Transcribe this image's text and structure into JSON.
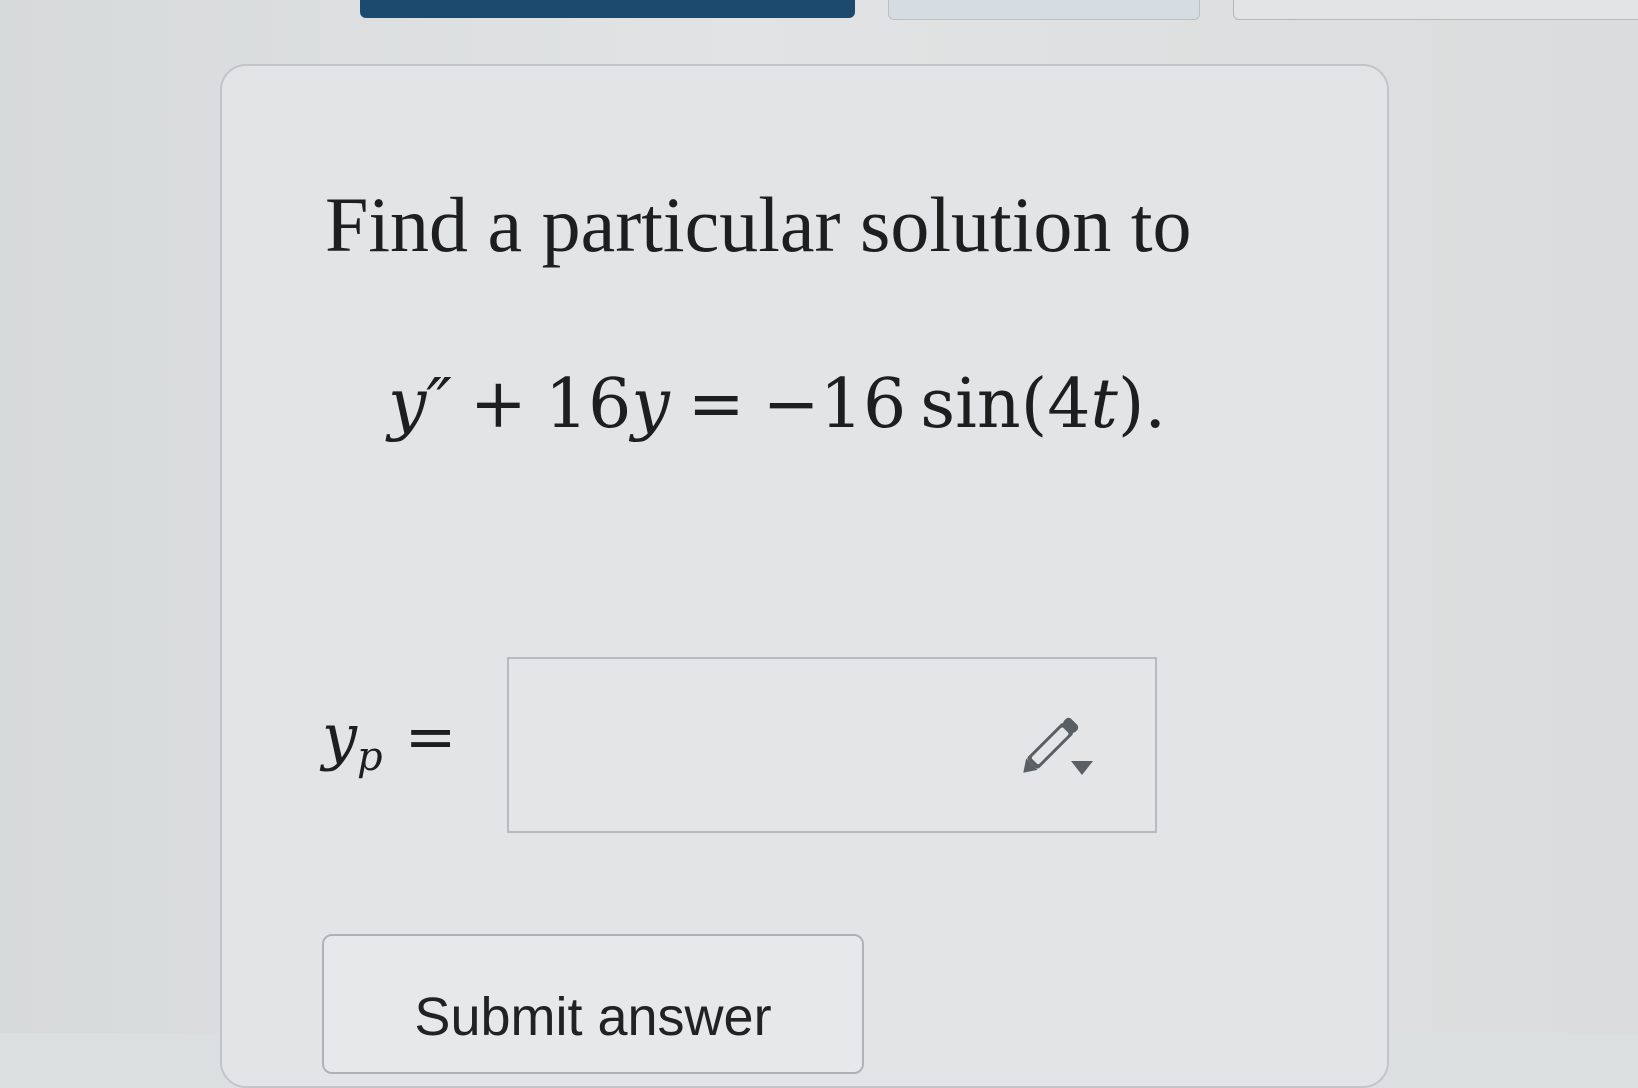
{
  "question": {
    "prompt": "Find a particular solution to",
    "equation": {
      "lhs_var": "y″",
      "plus": "+",
      "coef": "16",
      "lhs_var2": "y",
      "equals": "=",
      "minus": "−",
      "rhs_coef": "16",
      "func": "sin",
      "open_paren": "(",
      "arg_num": "4",
      "arg_var": "t",
      "close_paren": ").",
      "trailing": ""
    }
  },
  "answer": {
    "label_var": "y",
    "label_sub": "p",
    "label_eq": "=",
    "value": "",
    "edit_icon": "pencil-dropdown-icon"
  },
  "submit": {
    "label": "Submit answer"
  },
  "colors": {
    "tab_active": "#1c4a6e",
    "text": "#1e1e1e",
    "card_bg": "#e2e4e5",
    "icon": "#5a5f63"
  }
}
